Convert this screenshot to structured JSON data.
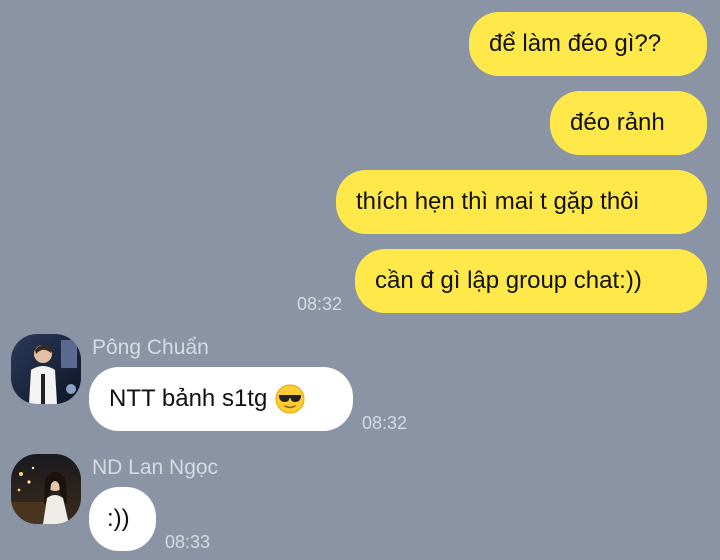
{
  "messages": {
    "outgoing": [
      {
        "text": "để làm đéo gì??"
      },
      {
        "text": "đéo rảnh"
      },
      {
        "text": "thích hẹn thì mai t gặp thôi"
      },
      {
        "text": "cần đ gì lập group chat:))"
      }
    ],
    "outgoing_time": "08:32"
  },
  "incoming": [
    {
      "sender": "Pông Chuẩn",
      "text": "NTT bảnh s1tg",
      "emoji": "sunglasses-face-icon",
      "time": "08:32"
    },
    {
      "sender": "ND Lan Ngọc",
      "text": ":))",
      "time": "08:33"
    }
  ],
  "colors": {
    "background": "#8b94a5",
    "outgoing_bubble": "#ffe94a",
    "incoming_bubble": "#ffffff",
    "meta_text": "#d5dae3"
  }
}
